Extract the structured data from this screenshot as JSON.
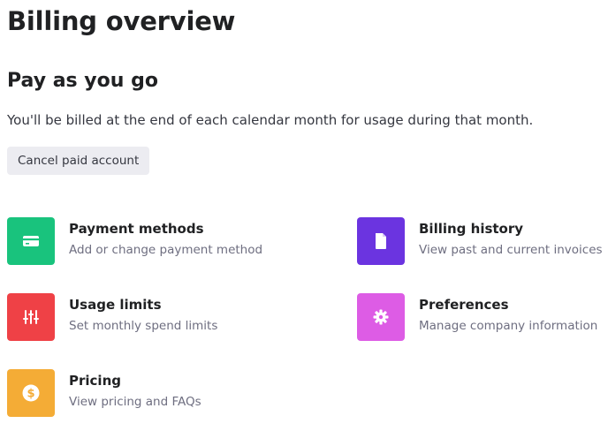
{
  "page": {
    "title": "Billing overview"
  },
  "plan": {
    "title": "Pay as you go",
    "description": "You'll be billed at the end of each calendar month for usage during that month.",
    "cancel_label": "Cancel paid account"
  },
  "cards": {
    "payment_methods": {
      "title": "Payment methods",
      "subtitle": "Add or change payment method",
      "icon": "credit-card-icon",
      "color": "#19c37d"
    },
    "billing_history": {
      "title": "Billing history",
      "subtitle": "View past and current invoices",
      "icon": "document-icon",
      "color": "#6b34e0"
    },
    "usage_limits": {
      "title": "Usage limits",
      "subtitle": "Set monthly spend limits",
      "icon": "sliders-icon",
      "color": "#ef4146"
    },
    "preferences": {
      "title": "Preferences",
      "subtitle": "Manage company information",
      "icon": "gear-icon",
      "color": "#dd5ce5"
    },
    "pricing": {
      "title": "Pricing",
      "subtitle": "View pricing and FAQs",
      "icon": "dollar-coin-icon",
      "color": "#f4ac36"
    }
  }
}
